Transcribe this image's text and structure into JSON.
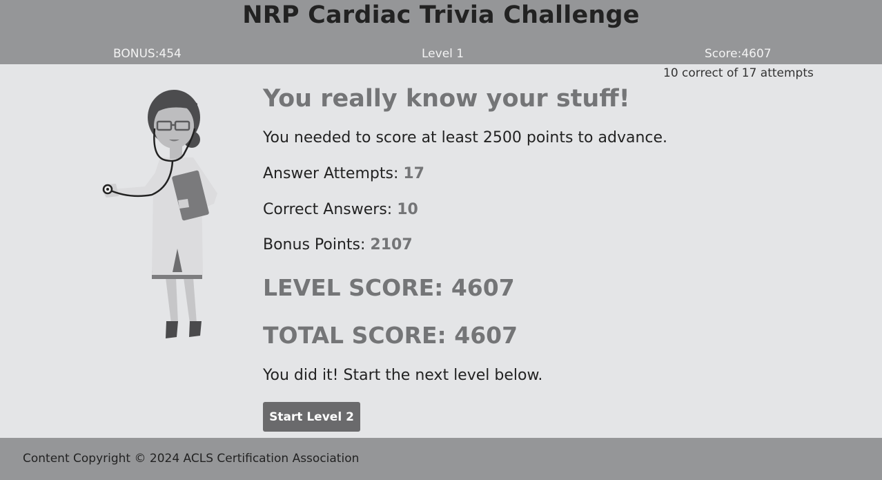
{
  "header": {
    "title": "NRP Cardiac Trivia Challenge",
    "bonus": "BONUS:454",
    "level": "Level 1",
    "score": "Score:4607"
  },
  "attempts_summary": "10 correct of 17 attempts",
  "results": {
    "heading": "You really know your stuff!",
    "required_text": "You needed to score at least 2500 points to advance.",
    "attempts_label": "Answer Attempts: ",
    "attempts_value": "17",
    "correct_label": "Correct Answers: ",
    "correct_value": "10",
    "bonus_label": "Bonus Points: ",
    "bonus_value": "2107",
    "level_score": "LEVEL SCORE: 4607",
    "total_score": "TOTAL SCORE: 4607",
    "next_level_msg": "You did it! Start the next level below.",
    "start_button_label": "Start Level 2"
  },
  "footer": {
    "copyright": "Content Copyright © 2024 ACLS Certification Association"
  },
  "illustration": {
    "icon": "doctor-with-stethoscope-illustration"
  }
}
